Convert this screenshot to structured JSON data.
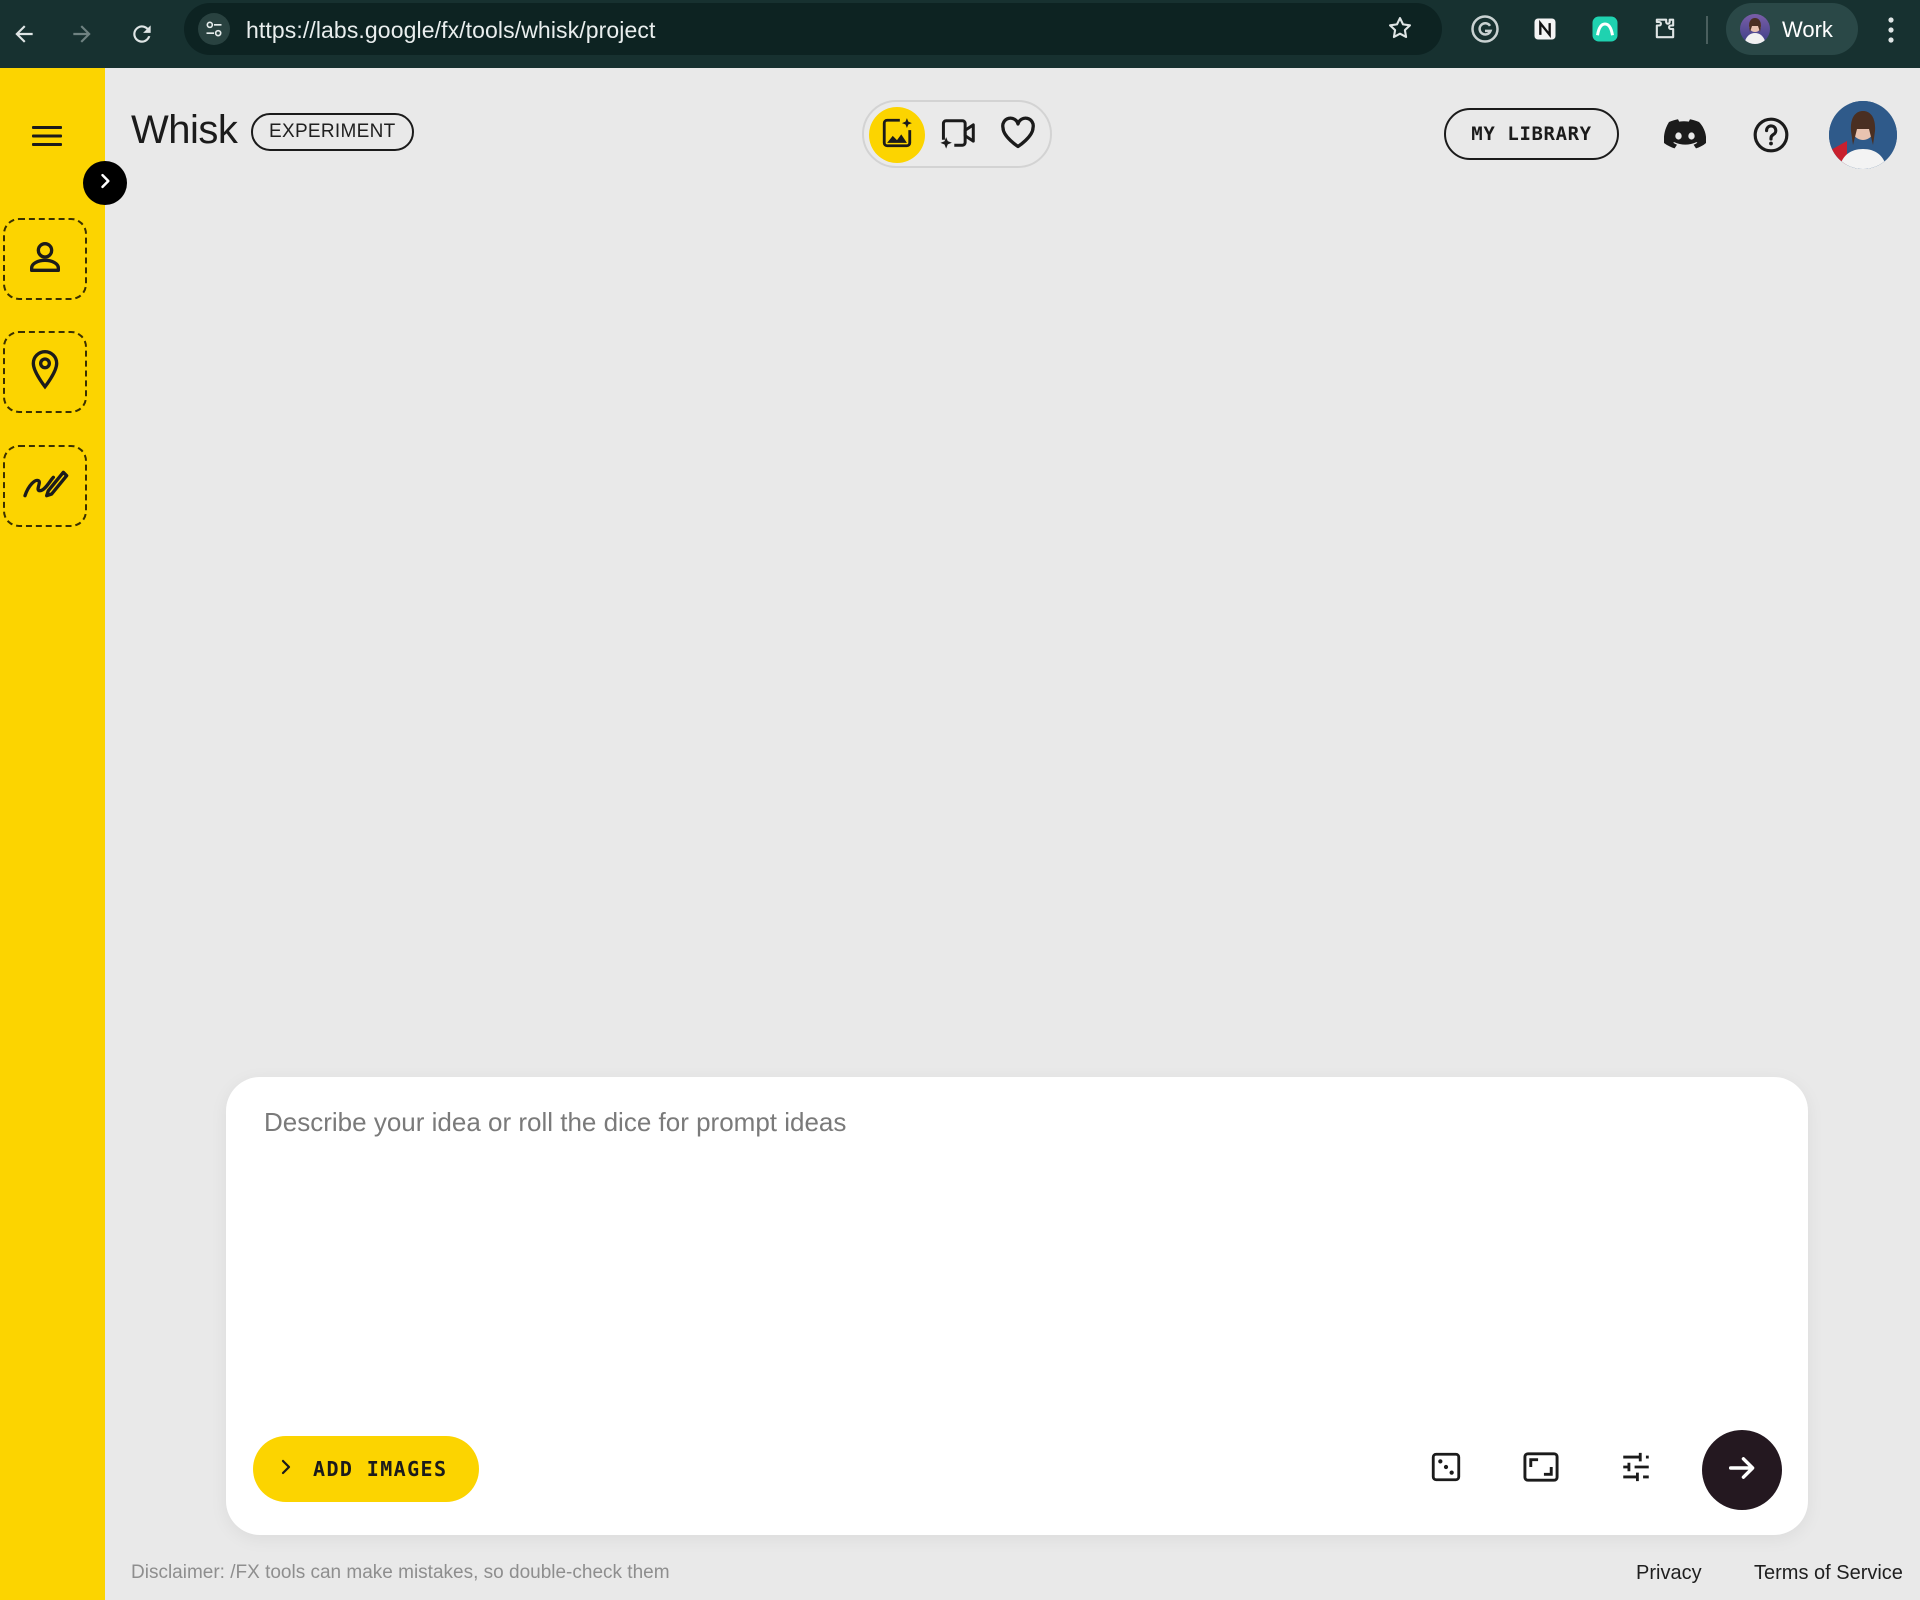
{
  "browser": {
    "url": "https://labs.google/fx/tools/whisk/project",
    "profile_name": "Work",
    "icons": [
      "back-arrow-icon",
      "forward-arrow-icon",
      "reload-icon",
      "site-settings-icon",
      "bookmark-star-icon",
      "grammarly-icon",
      "notion-icon",
      "extension-app-icon",
      "extensions-puzzle-icon",
      "chrome-menu-icon"
    ]
  },
  "sidebar": {
    "accent_color": "#fcd400",
    "slots": [
      {
        "name": "subject",
        "icon": "person-icon"
      },
      {
        "name": "scene",
        "icon": "location-pin-icon"
      },
      {
        "name": "style",
        "icon": "brush-style-icon"
      }
    ]
  },
  "header": {
    "brand": "Whisk",
    "badge": "EXPERIMENT",
    "modes": [
      {
        "name": "image",
        "icon": "image-sparkle-icon",
        "active": true
      },
      {
        "name": "video",
        "icon": "video-sparkle-icon",
        "active": false
      },
      {
        "name": "favorites",
        "icon": "heart-icon",
        "active": false
      }
    ],
    "library_label": "MY LIBRARY"
  },
  "prompt": {
    "placeholder": "Describe your idea or roll the dice for prompt ideas",
    "value": "",
    "add_images_label": "ADD IMAGES",
    "tools": [
      "dice-icon",
      "aspect-ratio-icon",
      "tune-sliders-icon"
    ]
  },
  "footer": {
    "disclaimer": "Disclaimer: /FX tools can make mistakes, so double-check them",
    "privacy": "Privacy",
    "terms": "Terms of Service"
  }
}
